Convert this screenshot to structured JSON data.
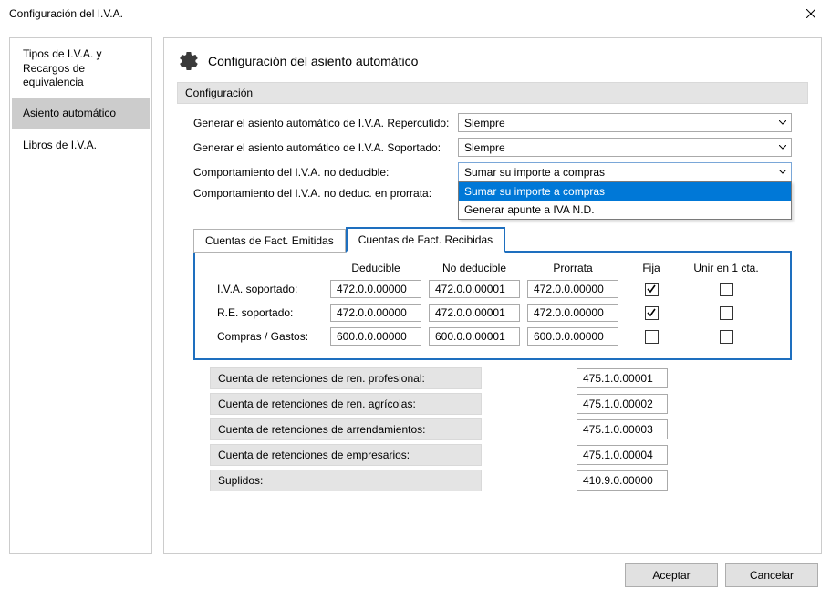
{
  "window": {
    "title": "Configuración del I.V.A."
  },
  "sidebar": {
    "items": [
      {
        "label": "Tipos de I.V.A. y Recargos de equivalencia",
        "selected": false,
        "twoline": true
      },
      {
        "label": "Asiento automático",
        "selected": true,
        "twoline": false
      },
      {
        "label": "Libros de I.V.A.",
        "selected": false,
        "twoline": false
      }
    ]
  },
  "main": {
    "heading": "Configuración del asiento automático",
    "section_label": "Configuración",
    "rows": {
      "r1_label": "Generar el asiento automático de I.V.A. Repercutido:",
      "r1_value": "Siempre",
      "r2_label": "Generar el asiento automático de I.V.A. Soportado:",
      "r2_value": "Siempre",
      "r3_label": "Comportamiento del I.V.A. no deducible:",
      "r3_value": "Sumar su importe a compras",
      "r4_label": "Comportamiento del I.V.A. no deduc. en prorrata:",
      "dropdown_opts": [
        "Sumar su importe a compras",
        "Generar apunte a IVA N.D."
      ]
    },
    "tabs": {
      "emitidas": "Cuentas de Fact. Emitidas",
      "recibidas": "Cuentas de Fact. Recibidas"
    },
    "grid": {
      "headers": {
        "deducible": "Deducible",
        "nodeducible": "No deducible",
        "prorrata": "Prorrata",
        "fija": "Fija",
        "unir": "Unir en 1 cta."
      },
      "rows": [
        {
          "label": "I.V.A. soportado:",
          "v1": "472.0.0.00000",
          "v2": "472.0.0.00001",
          "v3": "472.0.0.00000",
          "fija": true,
          "unir": false
        },
        {
          "label": "R.E. soportado:",
          "v1": "472.0.0.00000",
          "v2": "472.0.0.00001",
          "v3": "472.0.0.00000",
          "fija": true,
          "unir": false
        },
        {
          "label": "Compras / Gastos:",
          "v1": "600.0.0.00000",
          "v2": "600.0.0.00001",
          "v3": "600.0.0.00000",
          "fija": false,
          "unir": false
        }
      ]
    },
    "ret": [
      {
        "label": "Cuenta de retenciones de ren. profesional:",
        "value": "475.1.0.00001"
      },
      {
        "label": "Cuenta de retenciones de ren. agrícolas:",
        "value": "475.1.0.00002"
      },
      {
        "label": "Cuenta de retenciones de arrendamientos:",
        "value": "475.1.0.00003"
      },
      {
        "label": "Cuenta de retenciones de empresarios:",
        "value": "475.1.0.00004"
      },
      {
        "label": "Suplidos:",
        "value": "410.9.0.00000"
      }
    ]
  },
  "footer": {
    "accept": "Aceptar",
    "cancel": "Cancelar"
  }
}
